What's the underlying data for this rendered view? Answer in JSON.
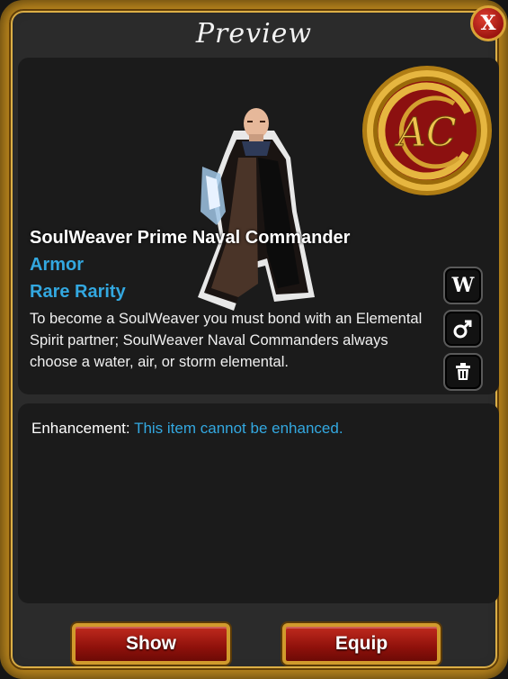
{
  "window": {
    "title": "Preview",
    "close_label": "X"
  },
  "item": {
    "name": "SoulWeaver Prime Naval Commander",
    "type": "Armor",
    "rarity": "Rare Rarity",
    "description": "To become a SoulWeaver you must bond with an Elemental Spirit partner; SoulWeaver Naval Commanders always choose a water, air, or storm elemental."
  },
  "emblem": {
    "text": "AC"
  },
  "side_buttons": [
    {
      "icon": "wiki-icon",
      "label": "W"
    },
    {
      "icon": "male-gender-icon"
    },
    {
      "icon": "trash-icon"
    }
  ],
  "enhancement": {
    "label": "Enhancement:",
    "value": "This item cannot be enhanced."
  },
  "buttons": {
    "show": "Show",
    "equip": "Equip"
  },
  "colors": {
    "accent_blue": "#33a8e0",
    "frame_gold": "#c08a1e",
    "button_red": "#a01a12"
  }
}
